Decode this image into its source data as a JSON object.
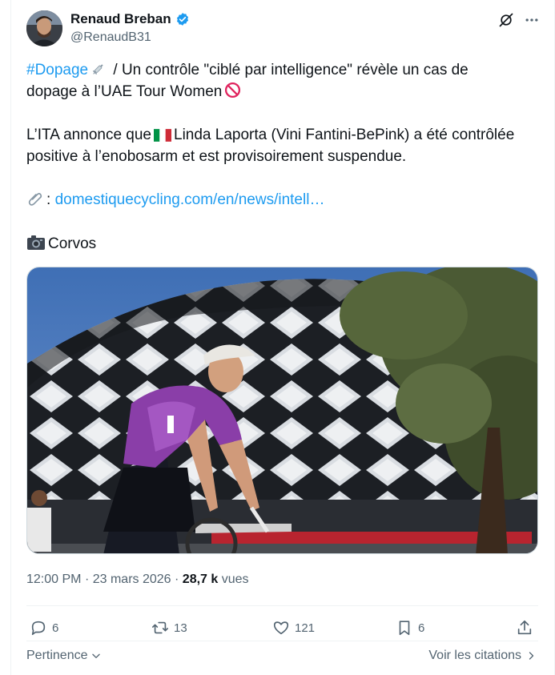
{
  "author": {
    "name": "Renaud Breban",
    "handle": "@RenaudB31"
  },
  "tweet": {
    "line1_hashtag": "#Dopage",
    "line1_rest": " / Un contrôle \"ciblé par intelligence\" révèle un cas de",
    "line2": "dopage à l’UAE Tour Women",
    "line3_start": "L’ITA annonce que",
    "line3_rest": "Linda Laporta (Vini Fantini-BePink) a été contrôlée",
    "line4": "positive à l’enobosarm et est provisoirement suspendue.",
    "link_prefix": ":",
    "link_text": "domestiquecycling.com/en/news/intell…",
    "photo_credit": "Corvos"
  },
  "meta": {
    "time": "12:00 PM",
    "separator": "·",
    "date": "23 mars 2026",
    "views_count": "28,7 k",
    "views_label": "vues"
  },
  "actions": {
    "replies": "6",
    "reposts": "13",
    "likes": "121",
    "bookmarks": "6"
  },
  "footer": {
    "sort_label": "Pertinence",
    "quotes_label": "Voir les citations"
  },
  "icons": [
    "verified-badge-icon",
    "grok-icon",
    "more-icon",
    "syringe-icon",
    "prohibited-icon",
    "italy-flag-icon",
    "paperclip-icon",
    "camera-icon",
    "reply-icon",
    "repost-icon",
    "like-icon",
    "bookmark-icon",
    "share-icon",
    "chevron-down-icon",
    "chevron-right-icon"
  ],
  "colors": {
    "accent": "#1d9bf0",
    "secondary_text": "#536471",
    "primary_text": "#0f1419"
  }
}
